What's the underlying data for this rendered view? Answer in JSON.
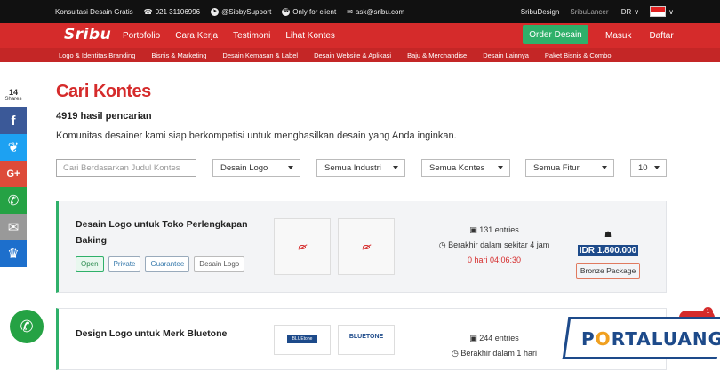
{
  "topbar": {
    "consult": "Konsultasi Desain Gratis",
    "phone": "021 31106996",
    "telegram": "@SibbySupport",
    "whatsapp": "Only for client",
    "email": "ask@sribu.com",
    "sribudesign": "SribuDesign",
    "sribulancer": "SribuLancer",
    "currency": "IDR"
  },
  "nav": {
    "logo": "Sribu",
    "links": [
      "Portofolio",
      "Cara Kerja",
      "Testimoni",
      "Lihat Kontes"
    ],
    "order": "Order Desain",
    "login": "Masuk",
    "register": "Daftar"
  },
  "categories": [
    "Logo & Identitas Branding",
    "Bisnis & Marketing",
    "Desain Kemasan & Label",
    "Desain Website & Aplikasi",
    "Baju & Merchandise",
    "Desain Lainnya",
    "Paket Bisnis & Combo"
  ],
  "share": {
    "count": "14",
    "label": "Shares"
  },
  "page": {
    "title": "Cari Kontes",
    "result_count": "4919 hasil pencarian",
    "description": "Komunitas desainer kami siap berkompetisi untuk menghasilkan desain yang Anda inginkan."
  },
  "filters": {
    "search_placeholder": "Cari Berdasarkan Judul Kontes",
    "category": "Desain Logo",
    "industry": "Semua Industri",
    "contest": "Semua Kontes",
    "feature": "Semua Fitur",
    "per_page": "10"
  },
  "contests": [
    {
      "title_line1": "Desain Logo untuk Toko Perlengkapan",
      "title_line2": "Baking",
      "tags": [
        "Open",
        "Private",
        "Guarantee",
        "Desain Logo"
      ],
      "entries": "131 entries",
      "ends": "Berakhir dalam sekitar 4 jam",
      "countdown": "0 hari 04:06:30",
      "prize": "IDR 1.800.000",
      "package": "Bronze Package"
    },
    {
      "title_line1": "Design Logo untuk Merk Bluetone",
      "entries": "244 entries",
      "ends": "Berakhir dalam 1 hari",
      "thumb_a": "BLUEtone",
      "thumb_b": "BLUETONE"
    }
  ],
  "watermark": {
    "brand_a": "P",
    "brand_o": "O",
    "brand_b": "RTALUANG",
    "badge": "1"
  },
  "colors": {
    "brand_red": "#d52b2b",
    "green": "#2fb06a",
    "navy": "#1d4a8a"
  }
}
